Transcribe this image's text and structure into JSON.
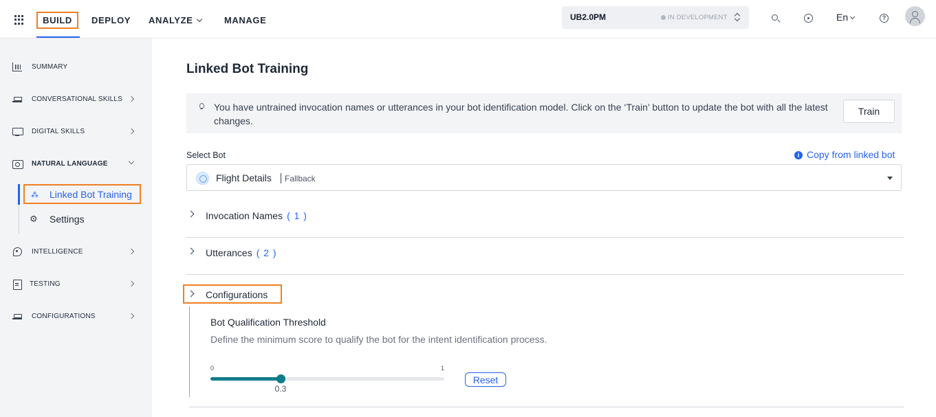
{
  "topnav": {
    "build": "BUILD",
    "deploy": "DEPLOY",
    "analyze": "ANALYZE",
    "manage": "MANAGE",
    "bot_name": "UB2.0PM",
    "bot_status": "IN DEVELOPMENT",
    "language": "En"
  },
  "sidebar": {
    "items": [
      {
        "label": "SUMMARY",
        "icon": "summary-icon"
      },
      {
        "label": "CONVERSATIONAL SKILLS",
        "icon": "conversational-skills-icon"
      },
      {
        "label": "DIGITAL SKILLS",
        "icon": "digital-skills-icon"
      },
      {
        "label": "NATURAL LANGUAGE",
        "icon": "natural-language-icon"
      },
      {
        "label": "INTELLIGENCE",
        "icon": "intelligence-icon"
      },
      {
        "label": "TESTING",
        "icon": "testing-icon"
      },
      {
        "label": "CONFIGURATIONS",
        "icon": "configurations-icon"
      }
    ],
    "sub_items": [
      {
        "label": "Linked Bot Training",
        "icon": "wand-icon"
      },
      {
        "label": "Settings",
        "icon": "gear-icon"
      }
    ]
  },
  "main": {
    "title": "Linked Bot Training",
    "banner_text": "You have untrained invocation names or utterances in your bot identification model. Click on the ‘Train’ button to update the bot with all the latest changes.",
    "train_label": "Train",
    "select_label": "Select Bot",
    "copy_link": "Copy from linked bot",
    "selected_bot": "Flight Details",
    "selected_bot_tag": "Fallback",
    "accordions": [
      {
        "label": "Invocation Names",
        "count": "( 1 )"
      },
      {
        "label": "Utterances",
        "count": "( 2 )"
      },
      {
        "label": "Configurations",
        "count": ""
      }
    ],
    "threshold": {
      "title": "Bot Qualification Threshold",
      "description": "Define the minimum score to qualify the bot for the intent identification process.",
      "min_label": "0",
      "max_label": "1",
      "value": 0.3,
      "value_label": "0.3",
      "reset_label": "Reset"
    }
  },
  "colors": {
    "accent": "#2563eb",
    "highlight_box": "#f07f22",
    "slider": "#0f7c8c"
  }
}
